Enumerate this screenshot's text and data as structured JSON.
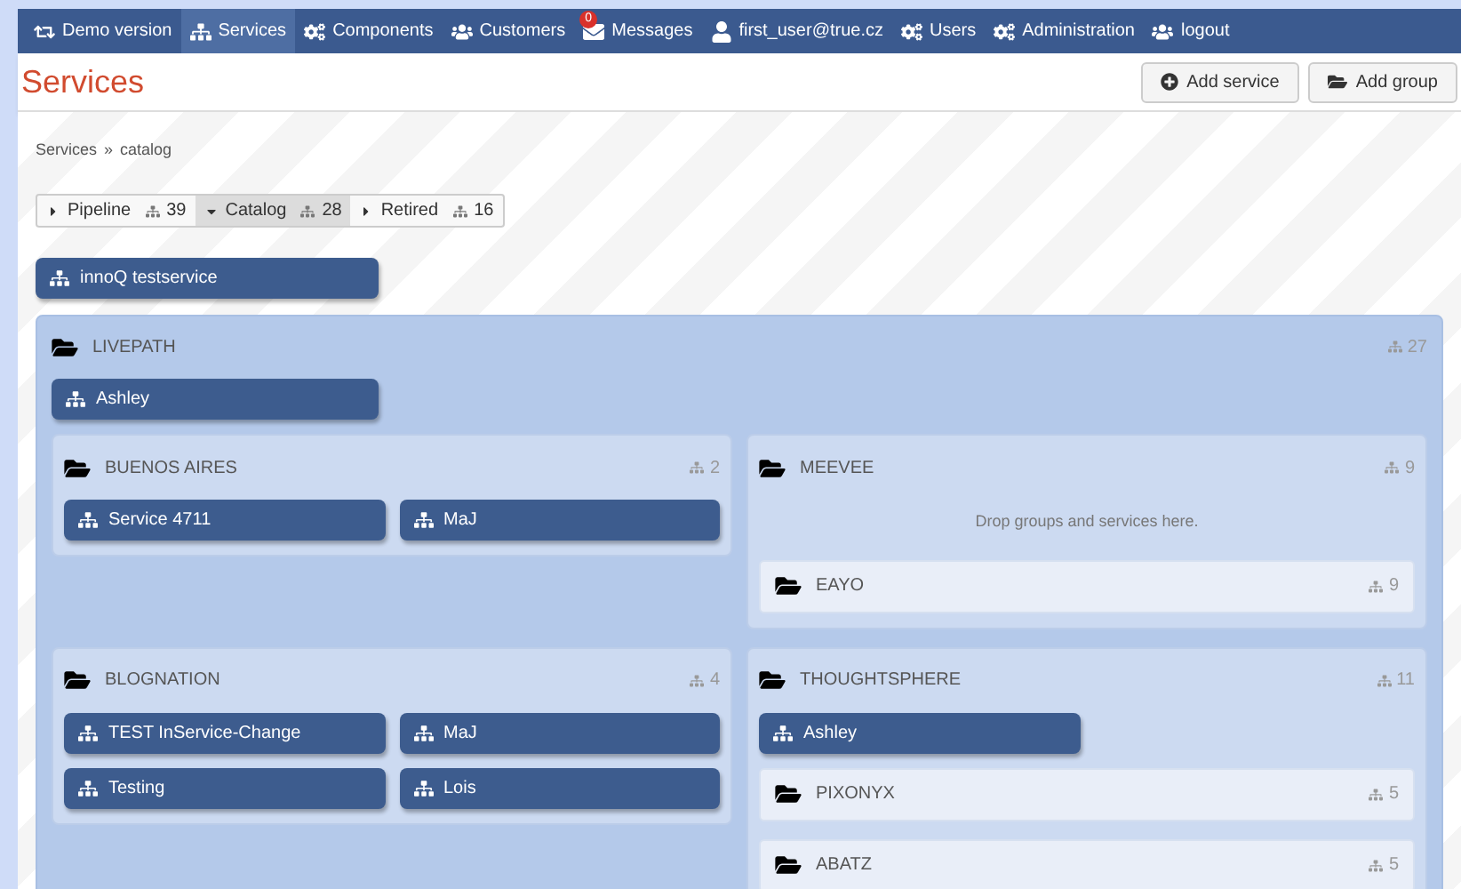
{
  "navbar": {
    "items": [
      {
        "kind": "demo",
        "label": "Demo version",
        "selected": false
      },
      {
        "kind": "services",
        "label": "Services",
        "selected": true
      },
      {
        "kind": "components",
        "label": "Components",
        "selected": false
      },
      {
        "kind": "customers",
        "label": "Customers",
        "selected": false
      },
      {
        "kind": "messages",
        "label": "Messages",
        "selected": false,
        "badge": "0"
      },
      {
        "kind": "user",
        "label": "first_user@true.cz",
        "selected": false
      },
      {
        "kind": "users",
        "label": "Users",
        "selected": false
      },
      {
        "kind": "administration",
        "label": "Administration",
        "selected": false
      },
      {
        "kind": "logout",
        "label": "logout",
        "selected": false
      }
    ]
  },
  "header": {
    "title": "Services",
    "buttons": [
      {
        "kind": "add",
        "label": "Add service"
      },
      {
        "kind": "folder",
        "label": "Add group"
      }
    ]
  },
  "breadcrumb": {
    "items": [
      "Services",
      "catalog"
    ],
    "separator": "»"
  },
  "tabs": [
    {
      "label": "Pipeline",
      "count": "39",
      "selected": false
    },
    {
      "label": "Catalog",
      "count": "28",
      "selected": true
    },
    {
      "label": "Retired",
      "count": "16",
      "selected": false
    }
  ],
  "services": [
    "innoQ testservice"
  ],
  "groups": [
    {
      "name": "LIVEPATH",
      "count": "27",
      "expanded": true,
      "services": [
        "Ashley"
      ],
      "groups": [
        {
          "name": "BUENOS AIRES",
          "count": "2",
          "expanded": true,
          "services": [
            "Service 4711",
            "MaJ"
          ]
        },
        {
          "name": "MEEVEE",
          "count": "9",
          "expanded": true,
          "drop_hint": "Drop groups and services here.",
          "groups": [
            {
              "name": "EAYO",
              "count": "9",
              "expanded": false
            }
          ]
        },
        {
          "name": "BLOGNATION",
          "count": "4",
          "expanded": true,
          "services": [
            "TEST InService-Change",
            "MaJ",
            "Testing",
            "Lois"
          ]
        },
        {
          "name": "THOUGHTSPHERE",
          "count": "11",
          "expanded": true,
          "services": [
            "Ashley"
          ],
          "groups": [
            {
              "name": "PIXONYX",
              "count": "5",
              "expanded": false
            },
            {
              "name": "ABATZ",
              "count": "5",
              "expanded": false
            }
          ]
        }
      ]
    }
  ]
}
